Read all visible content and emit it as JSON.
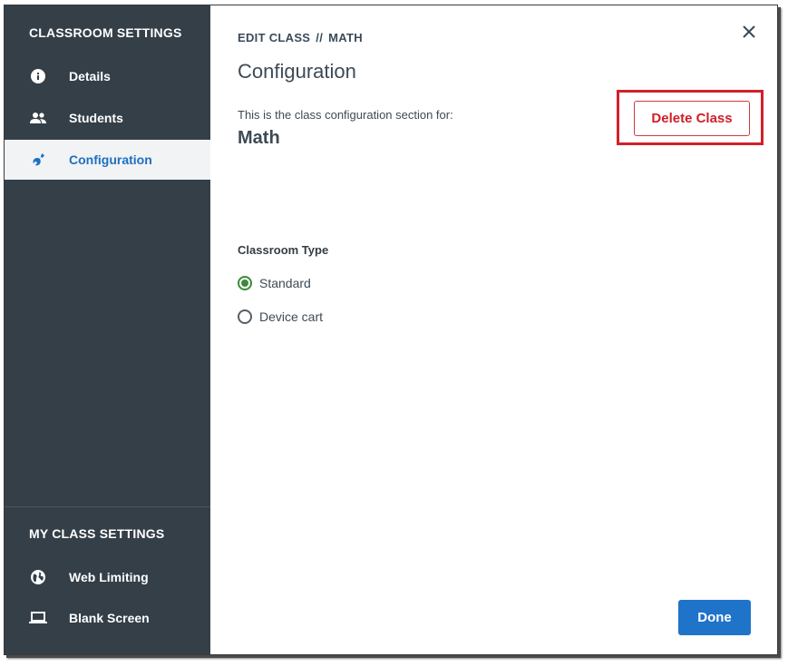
{
  "sidebar": {
    "classroom_heading": "CLASSROOM SETTINGS",
    "classroom_items": [
      {
        "label": "Details",
        "icon": "info-icon"
      },
      {
        "label": "Students",
        "icon": "people-icon"
      },
      {
        "label": "Configuration",
        "icon": "wrench-icon",
        "active": true
      }
    ],
    "my_heading": "MY CLASS SETTINGS",
    "my_items": [
      {
        "label": "Web Limiting",
        "icon": "globe-icon"
      },
      {
        "label": "Blank Screen",
        "icon": "laptop-icon"
      }
    ]
  },
  "main": {
    "breadcrumb": {
      "part1": "EDIT CLASS",
      "separator": "//",
      "part2": "MATH"
    },
    "title": "Configuration",
    "description": "This is the class configuration section for:",
    "class_name": "Math",
    "delete_label": "Delete Class",
    "classroom_type": {
      "label": "Classroom Type",
      "options": [
        {
          "label": "Standard",
          "selected": true
        },
        {
          "label": "Device cart",
          "selected": false
        }
      ]
    },
    "done_label": "Done"
  },
  "colors": {
    "sidebar_bg": "#343f48",
    "active_item_bg": "#f1f3f4",
    "active_item_text": "#1f6fc1",
    "delete_red": "#d01e28",
    "highlight_red": "#d21f2b",
    "radio_green": "#3d8b37",
    "done_blue": "#1f73c9"
  }
}
